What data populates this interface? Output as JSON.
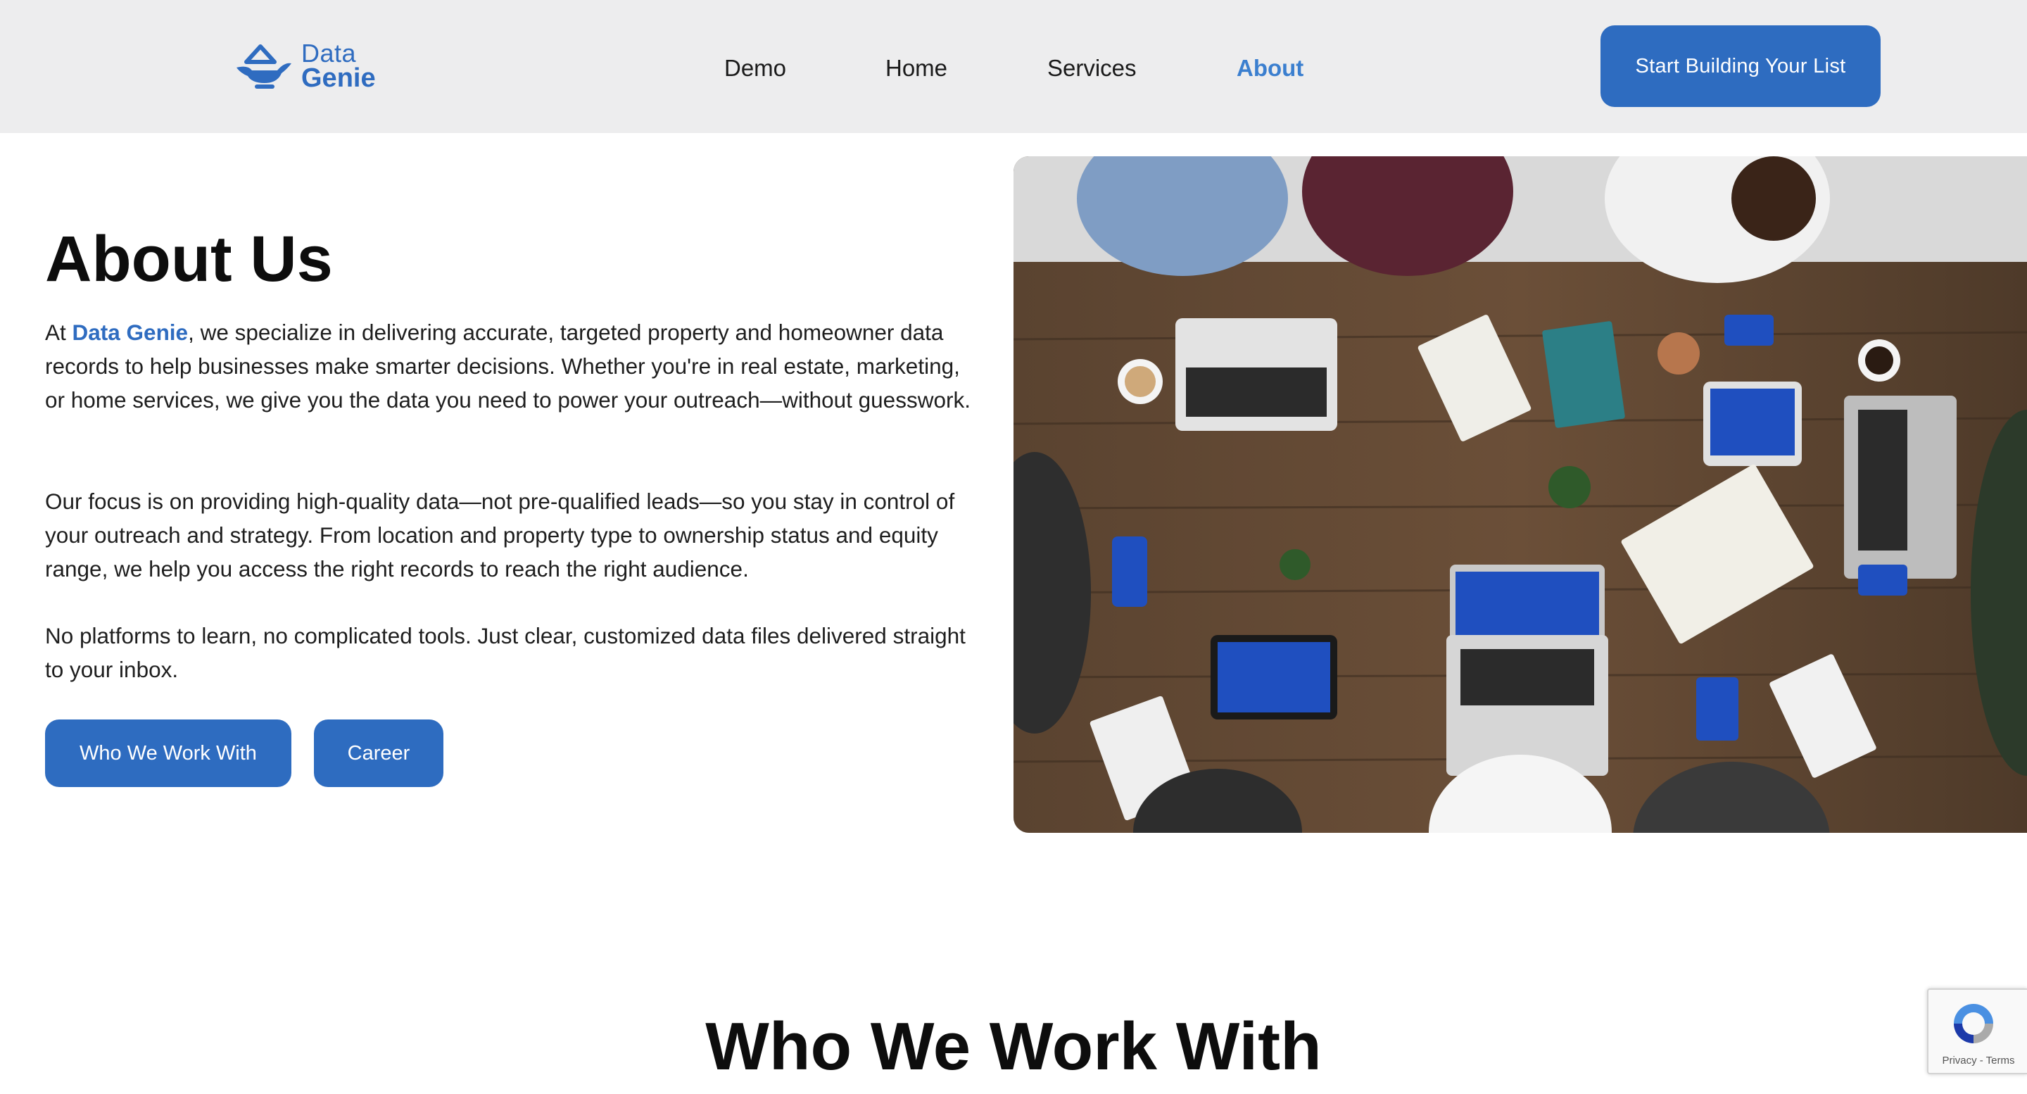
{
  "header": {
    "logo": {
      "line1": "Data",
      "line2": "Genie",
      "icon": "genie-lamp-icon"
    },
    "nav": [
      {
        "label": "Demo",
        "active": false
      },
      {
        "label": "Home",
        "active": false
      },
      {
        "label": "Services",
        "active": false
      },
      {
        "label": "About",
        "active": true
      }
    ],
    "cta_label": "Start Building Your List"
  },
  "about": {
    "title": "About Us",
    "p1_prefix": "At ",
    "p1_brand": "Data Genie",
    "p1_rest": ", we specialize in delivering accurate, targeted property and homeowner data records to help businesses make smarter decisions. Whether you're in real estate, marketing, or home services, we give you the data you need to power your outreach—without guesswork.",
    "p2": "Our focus is on providing high-quality data—not pre-qualified leads—so you stay in control of your outreach and strategy. From location and property type to ownership status and equity range, we help you access the right records to reach the right audience.",
    "p3": "No platforms to learn, no complicated tools. Just clear, customized data files delivered straight to your inbox.",
    "buttons": {
      "who": "Who We Work With",
      "career": "Career"
    }
  },
  "hero_image": {
    "alt": "team-meeting-photo"
  },
  "section2": {
    "title": "Who We Work With"
  },
  "recaptcha": {
    "links": "Privacy - Terms"
  },
  "colors": {
    "brand": "#2e6cc0",
    "active_nav": "#3b7fcf",
    "header_bg": "#ededee"
  }
}
